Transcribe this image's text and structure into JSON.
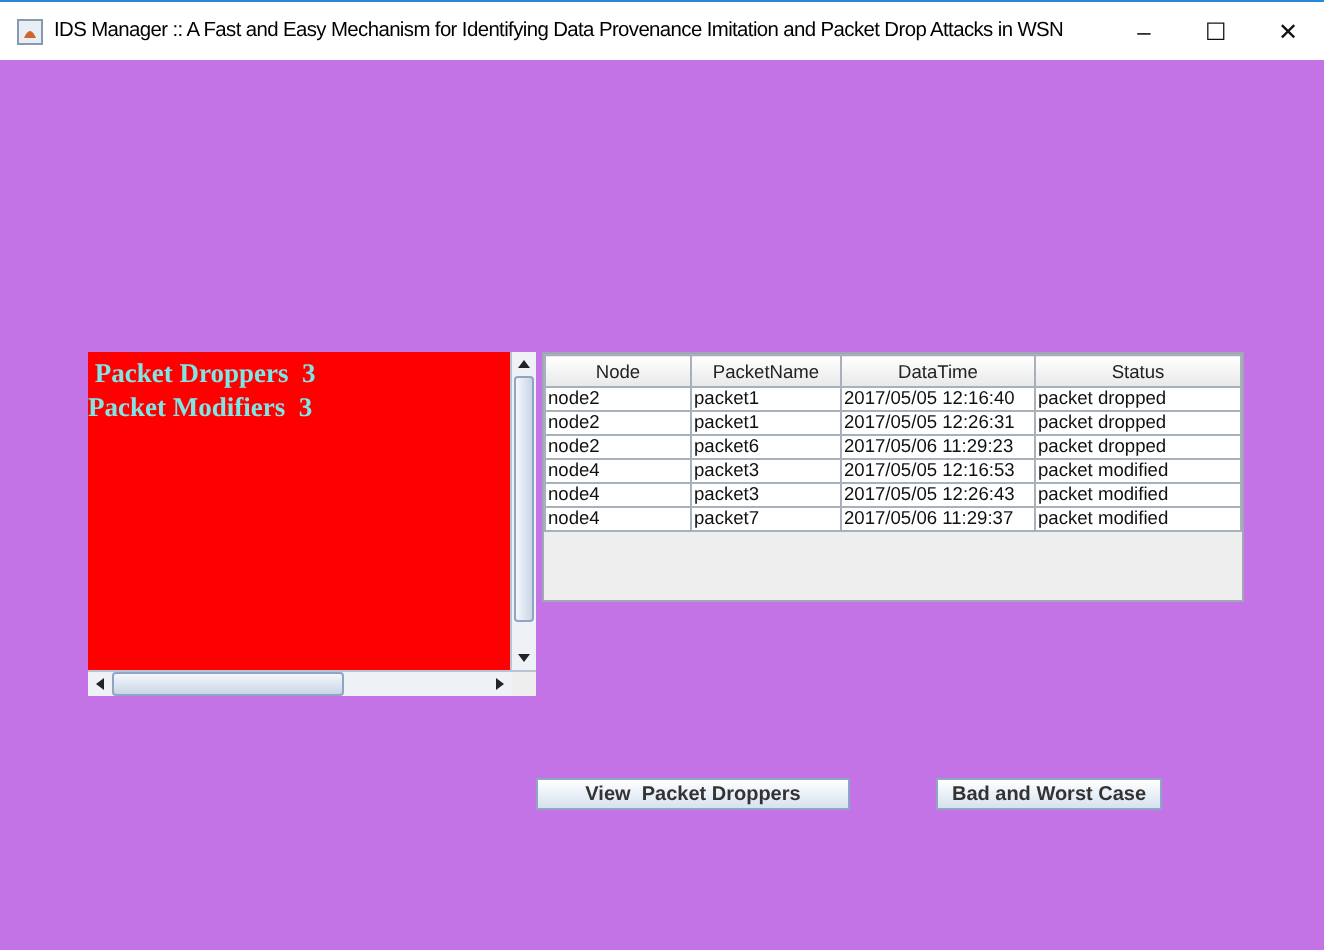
{
  "window": {
    "title": "IDS Manager :: A Fast and Easy Mechanism for Identifying Data Provenance Imitation and Packet Drop Attacks in WSN",
    "controls": [
      "–",
      "☐",
      "✕"
    ]
  },
  "text_area": {
    "lines": [
      " Packet Droppers  3",
      "Packet Modifiers  3"
    ]
  },
  "table": {
    "columns": [
      "Node",
      "PacketName",
      "DataTime",
      "Status"
    ],
    "rows": [
      [
        "node2",
        "packet1",
        "2017/05/05 12:16:40",
        "packet dropped"
      ],
      [
        "node2",
        "packet1",
        "2017/05/05 12:26:31",
        "packet dropped"
      ],
      [
        "node2",
        "packet6",
        "2017/05/06 11:29:23",
        "packet dropped"
      ],
      [
        "node4",
        "packet3",
        "2017/05/05 12:16:53",
        "packet modified"
      ],
      [
        "node4",
        "packet3",
        "2017/05/05 12:26:43",
        "packet modified"
      ],
      [
        "node4",
        "packet7",
        "2017/05/06 11:29:37",
        "packet modified"
      ]
    ]
  },
  "buttons": [
    "View  Packet Droppers",
    "Bad and Worst Case"
  ]
}
